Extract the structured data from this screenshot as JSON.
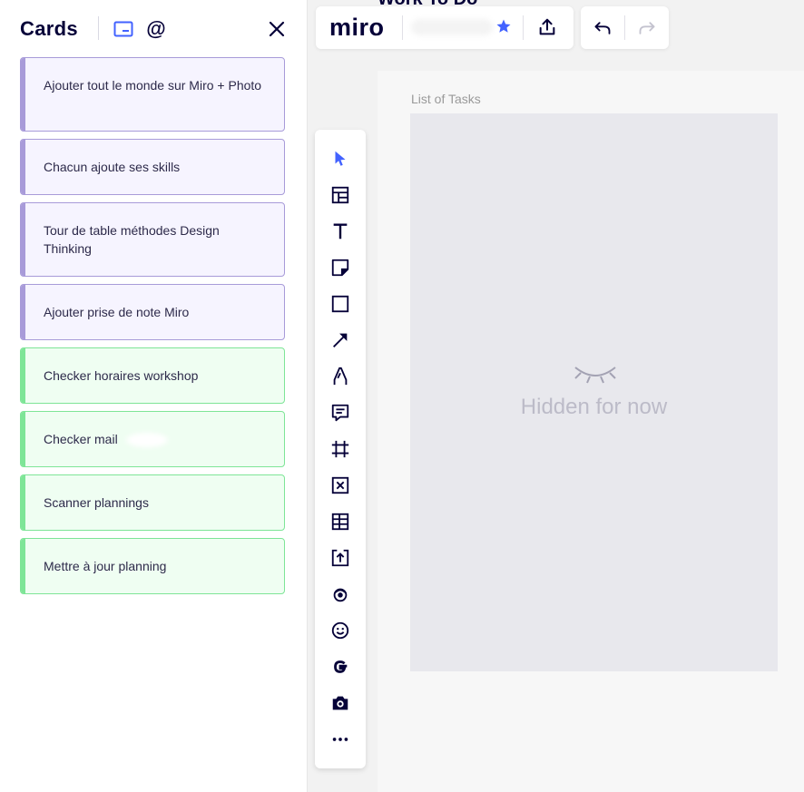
{
  "panel": {
    "title": "Cards",
    "cards": [
      {
        "text": "Ajouter tout le monde sur Miro + Photo",
        "color": "#a89bd9"
      },
      {
        "text": "Chacun ajoute ses skills",
        "color": "#a89bd9"
      },
      {
        "text": "Tour de table méthodes Design Thinking",
        "color": "#a89bd9"
      },
      {
        "text": "Ajouter prise de note Miro",
        "color": "#a89bd9"
      },
      {
        "text": "Checker horaires workshop",
        "color": "#7ee597"
      },
      {
        "text": "Checker mail",
        "color": "#7ee597"
      },
      {
        "text": "Scanner plannings",
        "color": "#7ee597"
      },
      {
        "text": "Mettre à jour planning",
        "color": "#7ee597"
      }
    ]
  },
  "topbar": {
    "logo": "miro",
    "star_color": "#4262ff"
  },
  "board": {
    "title": "Work To Do"
  },
  "frame": {
    "label": "List of Tasks",
    "hidden_text": "Hidden for now"
  },
  "toolbar": {
    "tools": [
      "select-icon",
      "templates-icon",
      "text-icon",
      "sticky-note-icon",
      "shape-icon",
      "connection-line-icon",
      "pen-icon",
      "comment-icon",
      "frame-icon",
      "card-icon",
      "table-icon",
      "upload-icon",
      "miroverse-icon",
      "emoji-icon",
      "google-icon",
      "camera-icon",
      "more-icon"
    ]
  }
}
